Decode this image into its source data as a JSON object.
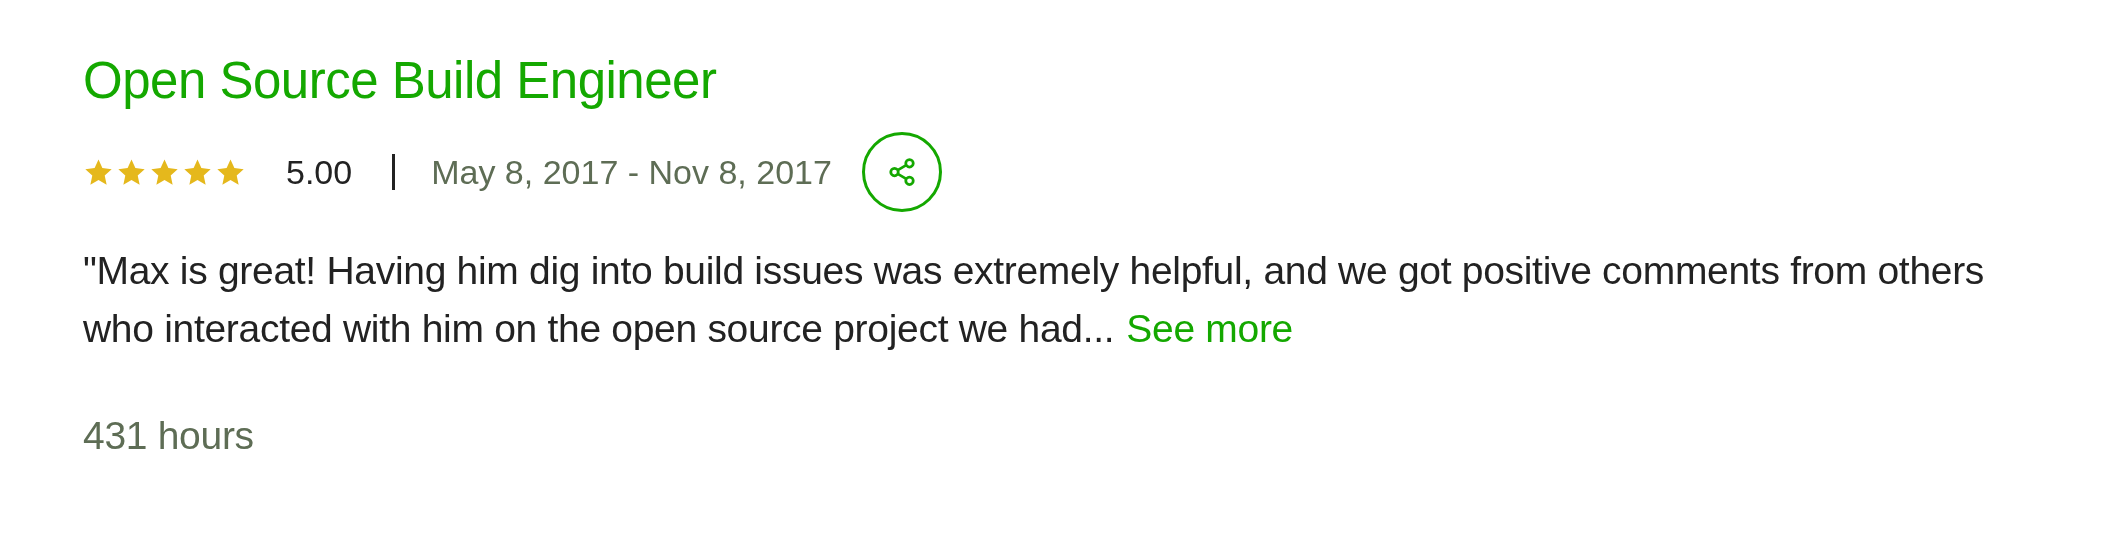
{
  "title": "Open Source Build Engineer",
  "rating": {
    "stars": 5,
    "score": "5.00"
  },
  "date_range": "May 8, 2017 - Nov 8, 2017",
  "comment": "\"Max is great! Having him dig into build issues was extremely helpful, and we got positive comments from others who interacted with him on the open source project we had...",
  "see_more": "See more",
  "hours": "431 hours"
}
